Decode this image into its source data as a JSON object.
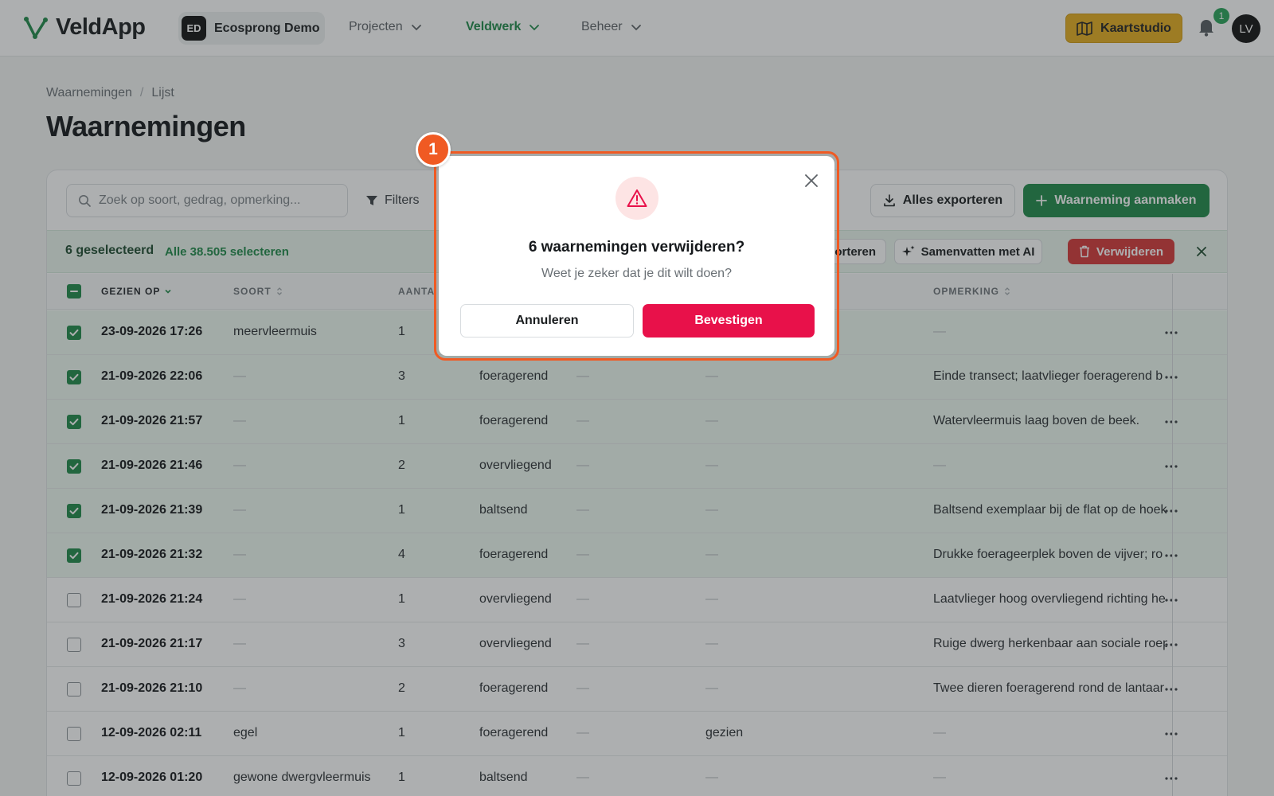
{
  "app": {
    "name": "VeldApp"
  },
  "workspace": {
    "initials": "ED",
    "name": "Ecosprong Demo"
  },
  "nav": [
    {
      "label": "Projecten",
      "active": false
    },
    {
      "label": "Veldwerk",
      "active": true
    },
    {
      "label": "Beheer",
      "active": false
    }
  ],
  "header": {
    "kaartstudio_label": "Kaartstudio",
    "notification_count": "1",
    "avatar_initials": "LV"
  },
  "breadcrumb": [
    "Waarnemingen",
    "/",
    "Lijst"
  ],
  "page": {
    "title": "Waarnemingen"
  },
  "toolbar": {
    "search_placeholder": "Zoek op soort, gedrag, opmerking...",
    "filters_label": "Filters",
    "export_all_label": "Alles exporteren",
    "create_label": "Waarneming aanmaken"
  },
  "selection": {
    "count_label": "6 geselecteerd",
    "select_all_label": "Alle 38.505 selecteren",
    "export_label": "xporteren",
    "ai_label": "Samenvatten met AI",
    "delete_label": "Verwijderen"
  },
  "table": {
    "headers": {
      "date": "GEZIEN OP",
      "species": "SOORT",
      "count": "AANTA",
      "remark": "OPMERKING"
    },
    "rows": [
      {
        "selected": true,
        "date": "23-09-2026 17:26",
        "species": "meervleermuis",
        "count": "1",
        "behavior": "",
        "c5": "",
        "c6": "",
        "remark": "—"
      },
      {
        "selected": true,
        "date": "21-09-2026 22:06",
        "species": "—",
        "count": "3",
        "behavior": "foeragerend",
        "c5": "—",
        "c6": "—",
        "remark": "Einde transect; laatvlieger foeragerend b"
      },
      {
        "selected": true,
        "date": "21-09-2026 21:57",
        "species": "—",
        "count": "1",
        "behavior": "foeragerend",
        "c5": "—",
        "c6": "—",
        "remark": "Watervleermuis laag boven de beek."
      },
      {
        "selected": true,
        "date": "21-09-2026 21:46",
        "species": "—",
        "count": "2",
        "behavior": "overvliegend",
        "c5": "—",
        "c6": "—",
        "remark": "—"
      },
      {
        "selected": true,
        "date": "21-09-2026 21:39",
        "species": "—",
        "count": "1",
        "behavior": "baltsend",
        "c5": "—",
        "c6": "—",
        "remark": "Baltsend exemplaar bij de flat op de hoek"
      },
      {
        "selected": true,
        "date": "21-09-2026 21:32",
        "species": "—",
        "count": "4",
        "behavior": "foeragerend",
        "c5": "—",
        "c6": "—",
        "remark": "Drukke foerageerplek boven de vijver; ro"
      },
      {
        "selected": false,
        "date": "21-09-2026 21:24",
        "species": "—",
        "count": "1",
        "behavior": "overvliegend",
        "c5": "—",
        "c6": "—",
        "remark": "Laatvlieger hoog overvliegend richting he"
      },
      {
        "selected": false,
        "date": "21-09-2026 21:17",
        "species": "—",
        "count": "3",
        "behavior": "overvliegend",
        "c5": "—",
        "c6": "—",
        "remark": "Ruige dwerg herkenbaar aan sociale roep"
      },
      {
        "selected": false,
        "date": "21-09-2026 21:10",
        "species": "—",
        "count": "2",
        "behavior": "foeragerend",
        "c5": "—",
        "c6": "—",
        "remark": "Twee dieren foeragerend rond de lantaar"
      },
      {
        "selected": false,
        "date": "12-09-2026 02:11",
        "species": "egel",
        "count": "1",
        "behavior": "foeragerend",
        "c5": "—",
        "c6": "gezien",
        "remark": "—"
      },
      {
        "selected": false,
        "date": "12-09-2026 01:20",
        "species": "gewone dwergvleermuis",
        "count": "1",
        "behavior": "baltsend",
        "c5": "—",
        "c6": "—",
        "remark": "—"
      }
    ]
  },
  "modal": {
    "step": "1",
    "title": "6 waarnemingen verwijderen?",
    "subtitle": "Weet je zeker dat je dit wilt doen?",
    "cancel_label": "Annuleren",
    "confirm_label": "Bevestigen"
  },
  "colors": {
    "brand_green": "#1f8a49",
    "danger": "#e8114a",
    "accent_yellow": "#e6ad1e",
    "highlight_orange": "#f05a23"
  }
}
